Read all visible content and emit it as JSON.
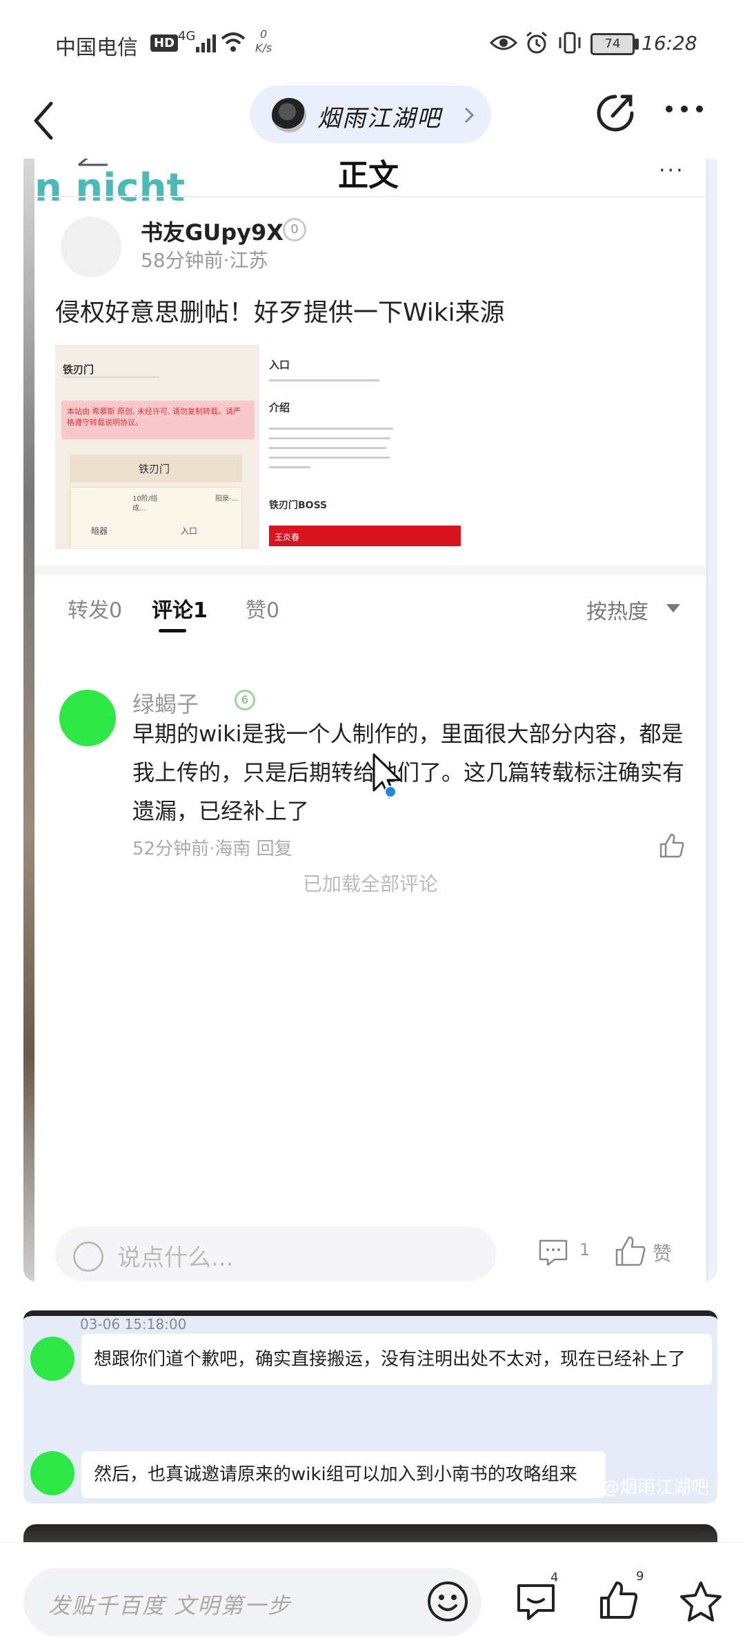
{
  "status_bar": {
    "carrier": "中国电信",
    "hd": "HD",
    "network": "4G",
    "speed_value": "0",
    "speed_unit": "K/s",
    "battery": "74",
    "time": "16:28"
  },
  "nav": {
    "forum_name": "烟雨江湖吧"
  },
  "embedded_post": {
    "ghost_text": "n nicht",
    "title": "正文",
    "more": "···",
    "author": "书友GUpy9X",
    "author_level": "0",
    "meta": "58分钟前·江苏",
    "text": "侵权好意思删帖！好歹提供一下Wiki来源",
    "image1": {
      "title": "铁刃门",
      "alert": "本站由 希慕斯 原创, 未经许可, 请勿复制转载。请严格遵守转载说明协议。",
      "button": "铁刃门",
      "cell_left": "暗器",
      "cell_mid": "入口",
      "col_text": "10阶/组成...",
      "col_right": "阳泉-..."
    },
    "image2": {
      "heading1": "入口",
      "heading2": "介绍",
      "heading3": "铁刃门BOSS",
      "red_bar": "王炎春"
    },
    "tabs": {
      "repost": "转发0",
      "comment": "评论1",
      "like": "赞0",
      "sort": "按热度"
    },
    "comment": {
      "user": "绿蝎子",
      "level": "6",
      "text": "早期的wiki是我一个人制作的，里面很大部分内容，都是我上传的，只是后期转给他们了。这几篇转载标注确实有遗漏，已经补上了",
      "meta": "52分钟前·海南  回复"
    },
    "loaded_all": "已加载全部评论",
    "reply_placeholder": "说点什么...",
    "comment_count": "1",
    "like_label": "赞"
  },
  "chat": {
    "timestamp": "03-06 15:18:00",
    "msg1": "想跟你们道个歉吧，确实直接搬运，没有注明出处不太对，现在已经补上了",
    "msg2": "然后，也真诚邀请原来的wiki组可以加入到小南书的攻略组来",
    "watermark": "@烟雨江湖吧"
  },
  "bottom_bar": {
    "input_placeholder": "发贴千百度 文明第一步",
    "comment_count": "4",
    "like_count": "9"
  },
  "colors": {
    "accent_pill": "#e9f0fb",
    "avatar_green": "#2ee848",
    "red_bar": "#d9141e"
  }
}
